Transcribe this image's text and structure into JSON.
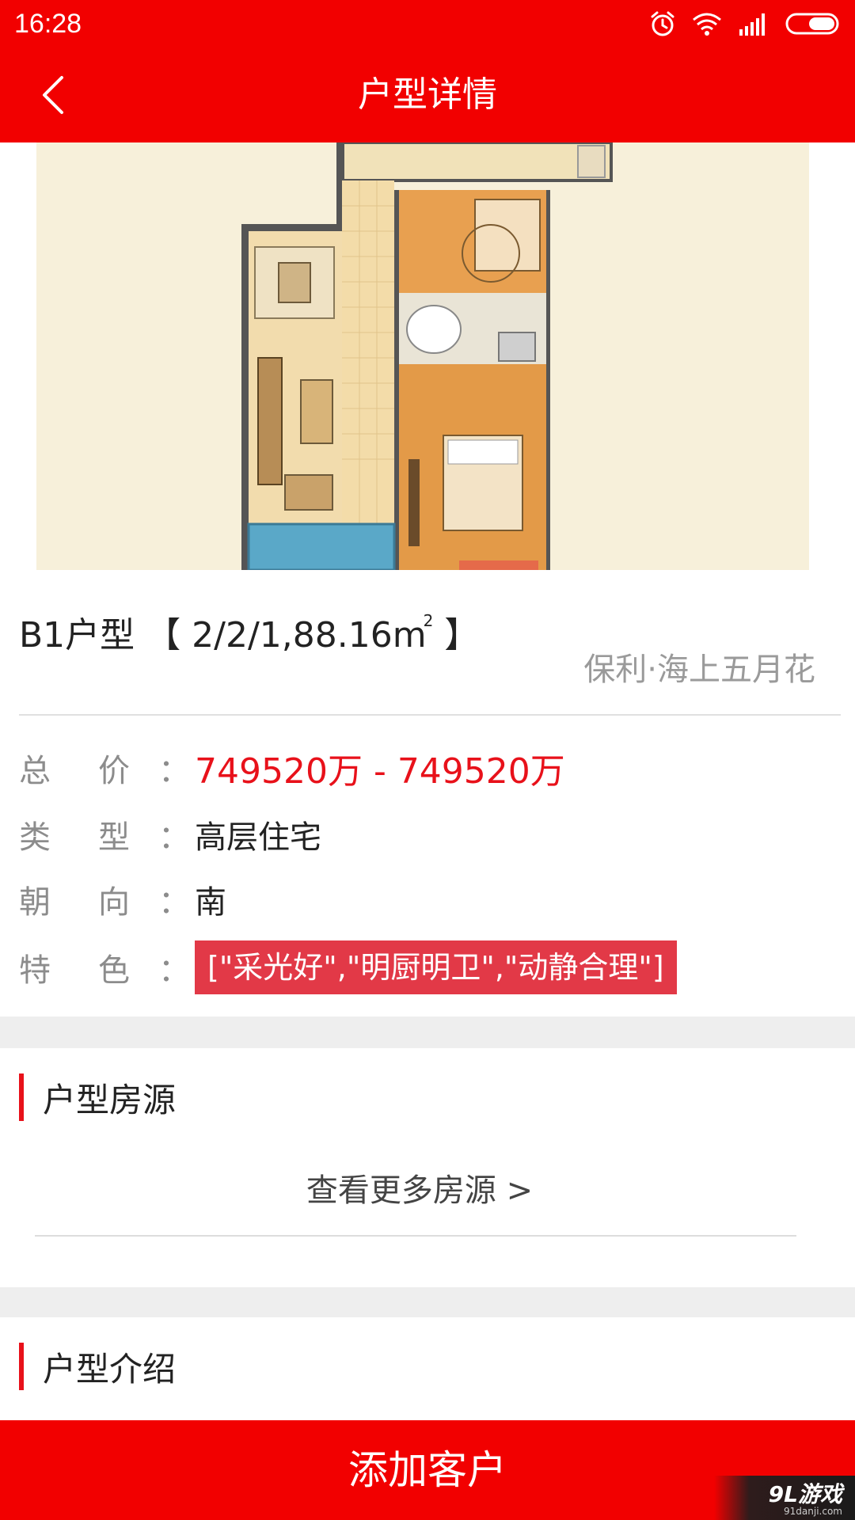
{
  "status_bar": {
    "time": "16:28",
    "icons": [
      "alarm-icon",
      "wifi-icon",
      "signal-icon",
      "battery-icon"
    ]
  },
  "header": {
    "title": "户型详情",
    "back_icon": "chevron-left-icon"
  },
  "unit": {
    "title": "B1户型 【 2/2/1,88.16m",
    "title_sup": "2",
    "title_end": " 】",
    "project": "保利·海上五月花"
  },
  "info": {
    "price": {
      "label_a": "总",
      "label_b": "价",
      "colon": "：",
      "value": "749520万 - 749520万"
    },
    "type": {
      "label_a": "类",
      "label_b": "型",
      "colon": "：",
      "value": "高层住宅"
    },
    "orientation": {
      "label_a": "朝",
      "label_b": "向",
      "colon": "：",
      "value": "南"
    },
    "features": {
      "label_a": "特",
      "label_b": "色",
      "colon": "：",
      "value": "[\"采光好\",\"明厨明卫\",\"动静合理\"]"
    }
  },
  "sections": {
    "listings": {
      "title": "户型房源",
      "more_link": "查看更多房源 >"
    },
    "intro": {
      "title": "户型介绍"
    }
  },
  "bottom_button": {
    "label": "添加客户"
  },
  "watermark": {
    "main": "9L游戏",
    "sub": "91danji.com"
  },
  "colors": {
    "brand_red": "#f20000",
    "price_red": "#e8111a",
    "tag_red": "#e23947",
    "floorplan_bg": "#f7f0da"
  }
}
